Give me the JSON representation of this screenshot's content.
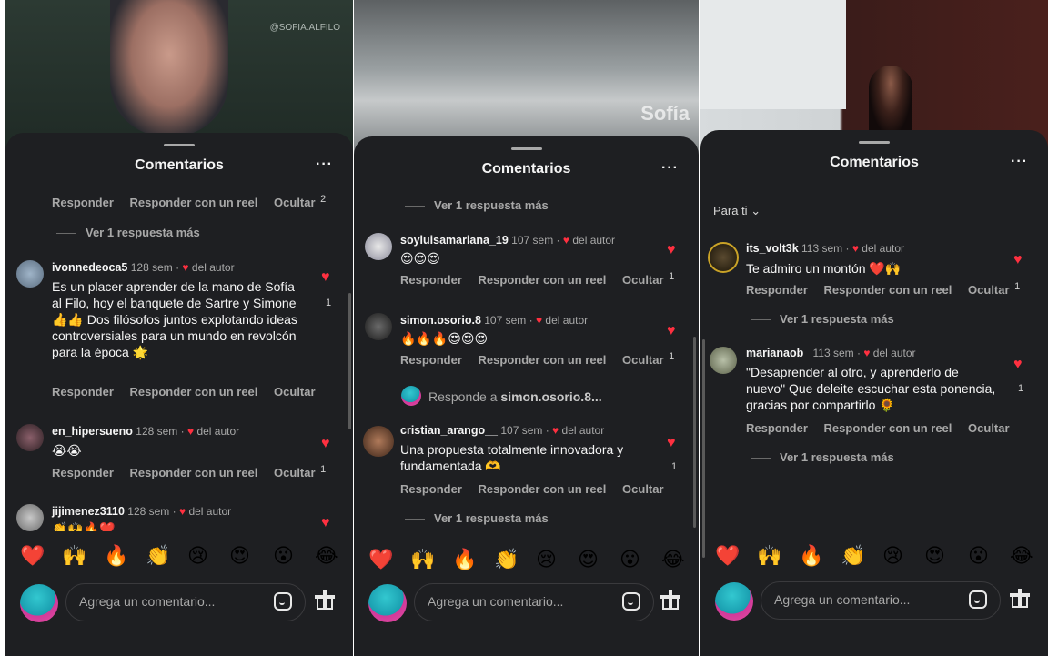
{
  "panels": [
    {
      "title": "Comentarios",
      "watermark": "@SOFIA.ALFILO",
      "top_actions": [
        "Responder",
        "Responder con un reel",
        "Ocultar"
      ],
      "top_actions_count": "2",
      "more_replies_top": "Ver 1 respuesta más",
      "comments": [
        {
          "user": "ivonnedeoca5",
          "meta": "128 sem · ",
          "author_like": "del autor",
          "text": "Es un placer aprender de la mano de Sofía al Filo, hoy el banquete de Sartre y Simone 👍👍 Dos filósofos juntos explotando ideas controversiales para un mundo en revolcón para la época 🌟",
          "likes": "1",
          "actions": [
            "Responder",
            "Responder con un reel",
            "Ocultar"
          ]
        },
        {
          "user": "en_hipersueno",
          "meta": "128 sem · ",
          "author_like": "del autor",
          "text": "😭😭",
          "actions": [
            "Responder",
            "Responder con un reel",
            "Ocultar"
          ],
          "actions_count": "1"
        },
        {
          "user": "jijimenez3110",
          "meta": "128 sem · ",
          "author_like": "del autor",
          "text": "👏🙌🔥❤️"
        }
      ]
    },
    {
      "title": "Comentarios",
      "slide_text": "Sofía",
      "more_replies_top": "Ver 1 respuesta más",
      "comments": [
        {
          "user": "soyluisamariana_19",
          "meta": "107 sem · ",
          "author_like": "del autor",
          "text": "😍😍😍",
          "actions": [
            "Responder",
            "Responder con un reel",
            "Ocultar"
          ],
          "actions_count": "1"
        },
        {
          "user": "simon.osorio.8",
          "meta": "107 sem · ",
          "author_like": "del autor",
          "text": "🔥🔥🔥😍😍😍",
          "actions": [
            "Responder",
            "Responder con un reel",
            "Ocultar"
          ],
          "actions_count": "1"
        },
        {
          "user": "cristian_arango__",
          "meta": "107 sem · ",
          "author_like": "del autor",
          "text": "Una propuesta totalmente innovadora y fundamentada 🫶",
          "likes": "1",
          "actions": [
            "Responder",
            "Responder con un reel",
            "Ocultar"
          ]
        }
      ],
      "reply_prompt_prefix": "Responde a ",
      "reply_prompt_user": "simon.osorio.8...",
      "more_replies_bottom": "Ver 1 respuesta más"
    },
    {
      "title": "Comentarios",
      "sort_label": "Para ti",
      "comments": [
        {
          "user": "its_volt3k",
          "meta": "113 sem · ",
          "author_like": "del autor",
          "text": "Te admiro un montón ❤️🙌",
          "actions": [
            "Responder",
            "Responder con un reel",
            "Ocultar"
          ],
          "actions_count": "1",
          "more_replies": "Ver 1 respuesta más"
        },
        {
          "user": "marianaob_",
          "meta": "113 sem · ",
          "author_like": "del autor",
          "text": "\"Desaprender al otro, y aprenderlo de nuevo\" Que deleite escuchar esta ponencia, gracias por compartirlo 🌻",
          "likes": "1",
          "actions": [
            "Responder",
            "Responder con un reel",
            "Ocultar"
          ],
          "more_replies": "Ver 1 respuesta más"
        }
      ]
    }
  ],
  "quick_emojis": [
    "❤️",
    "🙌",
    "🔥",
    "👏",
    "😢",
    "😍",
    "😮",
    "😂"
  ],
  "composer_placeholder": "Agrega un comentario...",
  "icons": {
    "sticker": "sticker-icon",
    "gift": "gift-icon",
    "like": "heart-icon",
    "more": "more-options-icon"
  },
  "colors": {
    "sheet_bg": "#1e1f22",
    "like_red": "#ff3040",
    "muted_text": "#a8a8a8"
  }
}
